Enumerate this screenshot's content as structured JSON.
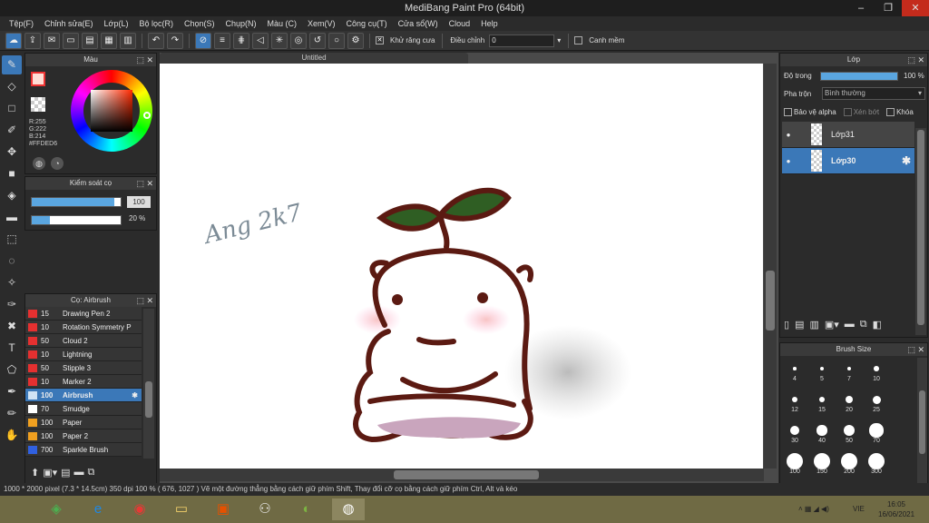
{
  "app": {
    "title": "MediBang Paint Pro (64bit)"
  },
  "window_controls": {
    "minimize": "–",
    "maximize": "❐",
    "close": "✕"
  },
  "menu": [
    "Tệp(F)",
    "Chỉnh sửa(E)",
    "Lớp(L)",
    "Bộ lọc(R)",
    "Chọn(S)",
    "Chụp(N)",
    "Màu (C)",
    "Xem(V)",
    "Công cụ(T)",
    "Cửa sổ(W)",
    "Cloud",
    "Help"
  ],
  "toolbar": {
    "antialias_label": "Khử răng cưa",
    "correction_label": "Điều chỉnh",
    "correction_value": "0",
    "edge_label": "Canh mềm"
  },
  "color_panel": {
    "title": "Màu",
    "r": "R:255",
    "g": "G:222",
    "b": "B:214",
    "hex": "#FFDED6",
    "fg_color": "#FFDED6"
  },
  "brush_control": {
    "title": "Kiểm soát cọ",
    "size": "100",
    "opacity": "20 %",
    "size_fraction": 0.93,
    "opacity_fraction": 0.2
  },
  "brush_panel": {
    "title": "Cọ: Airbrush",
    "items": [
      {
        "size": "15",
        "name": "Drawing Pen 2",
        "color": "#e53030"
      },
      {
        "size": "10",
        "name": "Rotation Symmetry P",
        "color": "#e53030"
      },
      {
        "size": "50",
        "name": "Cloud 2",
        "color": "#e53030"
      },
      {
        "size": "10",
        "name": "Lightning",
        "color": "#e53030"
      },
      {
        "size": "50",
        "name": "Stipple 3",
        "color": "#e53030"
      },
      {
        "size": "10",
        "name": "Marker 2",
        "color": "#e53030"
      },
      {
        "size": "100",
        "name": "Airbrush",
        "color": "#cfe3f5",
        "selected": true
      },
      {
        "size": "70",
        "name": "Smudge",
        "color": "#ffffff"
      },
      {
        "size": "100",
        "name": "Paper",
        "color": "#f0a020"
      },
      {
        "size": "100",
        "name": "Paper 2",
        "color": "#f0a020"
      },
      {
        "size": "700",
        "name": "Sparkle Brush",
        "color": "#3060e0"
      }
    ]
  },
  "canvas": {
    "tab_title": "Untitled",
    "signature": "Ang 2k7"
  },
  "layer_panel": {
    "title": "Lớp",
    "opacity_label": "Độ trong",
    "opacity_value": "100 %",
    "opacity_fraction": 1.0,
    "blend_label": "Pha trộn",
    "blend_value": "Bình thường",
    "protect_alpha": "Bảo vệ alpha",
    "clipping": "Xén bớt",
    "lock": "Khóa",
    "layers": [
      {
        "name": "Lớp31",
        "selected": false
      },
      {
        "name": "Lớp30",
        "selected": true
      }
    ]
  },
  "brush_size_panel": {
    "title": "Brush Size",
    "sizes": [
      "4",
      "5",
      "7",
      "10",
      "12",
      "15",
      "20",
      "25",
      "30",
      "40",
      "50",
      "70",
      "100",
      "150",
      "200",
      "300"
    ]
  },
  "status": {
    "text": "1000 * 2000 pixel   (7.3 * 14.5cm)   350 dpi   100 %   ( 676, 1027 )  Vẽ một đường thẳng bằng cách giữ phím Shift, Thay đổi cỡ cọ bằng cách giữ phím Ctrl, Alt và kéo"
  },
  "taskbar": {
    "lang": "VIE",
    "time": "16:05",
    "date": "16/06/2021"
  }
}
